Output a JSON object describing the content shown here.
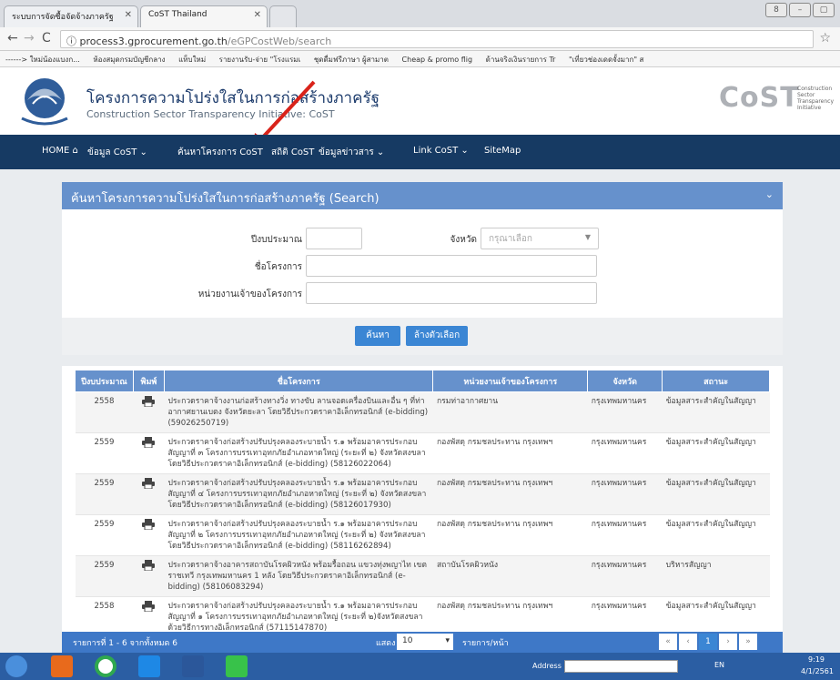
{
  "browser": {
    "tabs": [
      {
        "label": "ระบบการจัดซื้อจัดจ้างภาครัฐ"
      },
      {
        "label": "CoST Thailand"
      }
    ],
    "url_host": "process3.gprocurement.go.th",
    "url_path": "/eGPCostWeb/search",
    "bookmarks": [
      "------> ใหม่น้องแบงก...",
      "ห้องสมุดกรมบัญชีกลาง",
      "แท็บใหม่",
      "รายงานรับ-จ่าย \"โรงแรมเ",
      "ชุดดื่มฟรีภาษา ผู้สามาต",
      "Cheap & promo flig",
      "ด้านจริงเงินรายการ Tr",
      "\"เที่ยวช่องเดดจั้งมาก\" ส"
    ]
  },
  "site": {
    "title_th": "โครงการความโปร่งใสในการก่อสร้างภาครัฐ",
    "title_en": "Construction Sector Transparency Initiative: CoST",
    "brand": "CoST",
    "brand_sub": "Construction Sector Transparency Initiative",
    "nav": [
      "HOME",
      "ข้อมูล CoST",
      "ค้นหาโครงการ CoST",
      "สถิติ CoST",
      "ข้อมูลข่าวสาร",
      "Link CoST",
      "SiteMap"
    ]
  },
  "search": {
    "title": "ค้นหาโครงการความโปร่งใสในการก่อสร้างภาครัฐ (Search)",
    "budget_year_label": "ปีงบประมาณ",
    "province_label": "จังหวัด",
    "province_placeholder": "กรุณาเลือก",
    "project_name_label": "ชื่อโครงการ",
    "owner_label": "หน่วยงานเจ้าของโครงการ",
    "search_button": "ค้นหา",
    "clear_button": "ล้างตัวเลือก"
  },
  "table": {
    "headers": [
      "ปีงบประมาณ",
      "พิมพ์",
      "ชื่อโครงการ",
      "หน่วยงานเจ้าของโครงการ",
      "จังหวัด",
      "สถานะ"
    ],
    "rows": [
      {
        "year": "2558",
        "name": "ประกวดราคาจ้างงานก่อสร้างทางวิ่ง ทางขับ ลานจอดเครื่องบินและอื่น ๆ ที่ท่าอากาศยานเบตง จังหวัดยะลา โดยวิธีประกวดราคาอิเล็กทรอนิกส์ (e-bidding) (59026250719)",
        "owner": "กรมท่าอากาศยาน",
        "province": "กรุงเทพมหานคร",
        "status": "ข้อมูลสาระสำคัญในสัญญา"
      },
      {
        "year": "2559",
        "name": "ประกวดราคาจ้างก่อสร้างปรับปรุงคลองระบายน้ำ ร.๑ พร้อมอาคารประกอบ สัญญาที่ ๓ โครงการบรรเทาอุทกภัยอำเภอหาดใหญ่ (ระยะที่ ๒) จังหวัดสงขลา โดยวิธีประกวดราคาอิเล็กทรอนิกส์ (e-bidding) (58126022064)",
        "owner": "กองพัสดุ กรมชลประทาน กรุงเทพฯ",
        "province": "กรุงเทพมหานคร",
        "status": "ข้อมูลสาระสำคัญในสัญญา"
      },
      {
        "year": "2559",
        "name": "ประกวดราคาจ้างก่อสร้างปรับปรุงคลองระบายน้ำ ร.๑ พร้อมอาคารประกอบ สัญญาที่ ๔ โครงการบรรเทาอุทกภัยอำเภอหาดใหญ่ (ระยะที่ ๒) จังหวัดสงขลา โดยวิธีประกวดราคาอิเล็กทรอนิกส์ (e-bidding) (58126017930)",
        "owner": "กองพัสดุ กรมชลประทาน กรุงเทพฯ",
        "province": "กรุงเทพมหานคร",
        "status": "ข้อมูลสาระสำคัญในสัญญา"
      },
      {
        "year": "2559",
        "name": "ประกวดราคาจ้างก่อสร้างปรับปรุงคลองระบายน้ำ ร.๑ พร้อมอาคารประกอบ สัญญาที่ ๒ โครงการบรรเทาอุทกภัยอำเภอหาดใหญ่ (ระยะที่ ๒) จังหวัดสงขลา โดยวิธีประกวดราคาอิเล็กทรอนิกส์ (e-bidding) (58116262894)",
        "owner": "กองพัสดุ กรมชลประทาน กรุงเทพฯ",
        "province": "กรุงเทพมหานคร",
        "status": "ข้อมูลสาระสำคัญในสัญญา"
      },
      {
        "year": "2559",
        "name": "ประกวดราคาจ้างอาคารสถาบันโรคผิวหนัง พร้อมรื้อถอน แขวงทุ่งพญาไท เขตราชเทวี กรุงเทพมหานคร 1 หลัง โดยวิธีประกวดราคาอิเล็กทรอนิกส์ (e-bidding) (58106083294)",
        "owner": "สถาบันโรคผิวหนัง",
        "province": "กรุงเทพมหานคร",
        "status": "บริหารสัญญา"
      },
      {
        "year": "2558",
        "name": "ประกวดราคาจ้างก่อสร้างปรับปรุงคลองระบายน้ำ ร.๑ พร้อมอาคารประกอบ สัญญาที่ ๑ โครงการบรรเทาอุทกภัยอำเภอหาดใหญ่ (ระยะที่ ๒)จังหวัดสงขลา ด้วยวิธีการทางอิเล็กทรอนิกส์ (57115147870)",
        "owner": "กองพัสดุ กรมชลประทาน กรุงเทพฯ",
        "province": "กรุงเทพมหานคร",
        "status": "ข้อมูลสาระสำคัญในสัญญา"
      }
    ]
  },
  "pager": {
    "summary": "รายการที่ 1 - 6 จากทั้งหมด 6",
    "show_label": "แสดง",
    "per_page": "10",
    "per_page_suffix": "รายการ/หน้า",
    "current_page": "1"
  },
  "taskbar": {
    "address_label": "Address",
    "lang": "EN",
    "time": "9:19",
    "date": "4/1/2561"
  },
  "colors": {
    "nav": "#163a63",
    "panel_header": "#6691cc",
    "button": "#3b86d4"
  }
}
